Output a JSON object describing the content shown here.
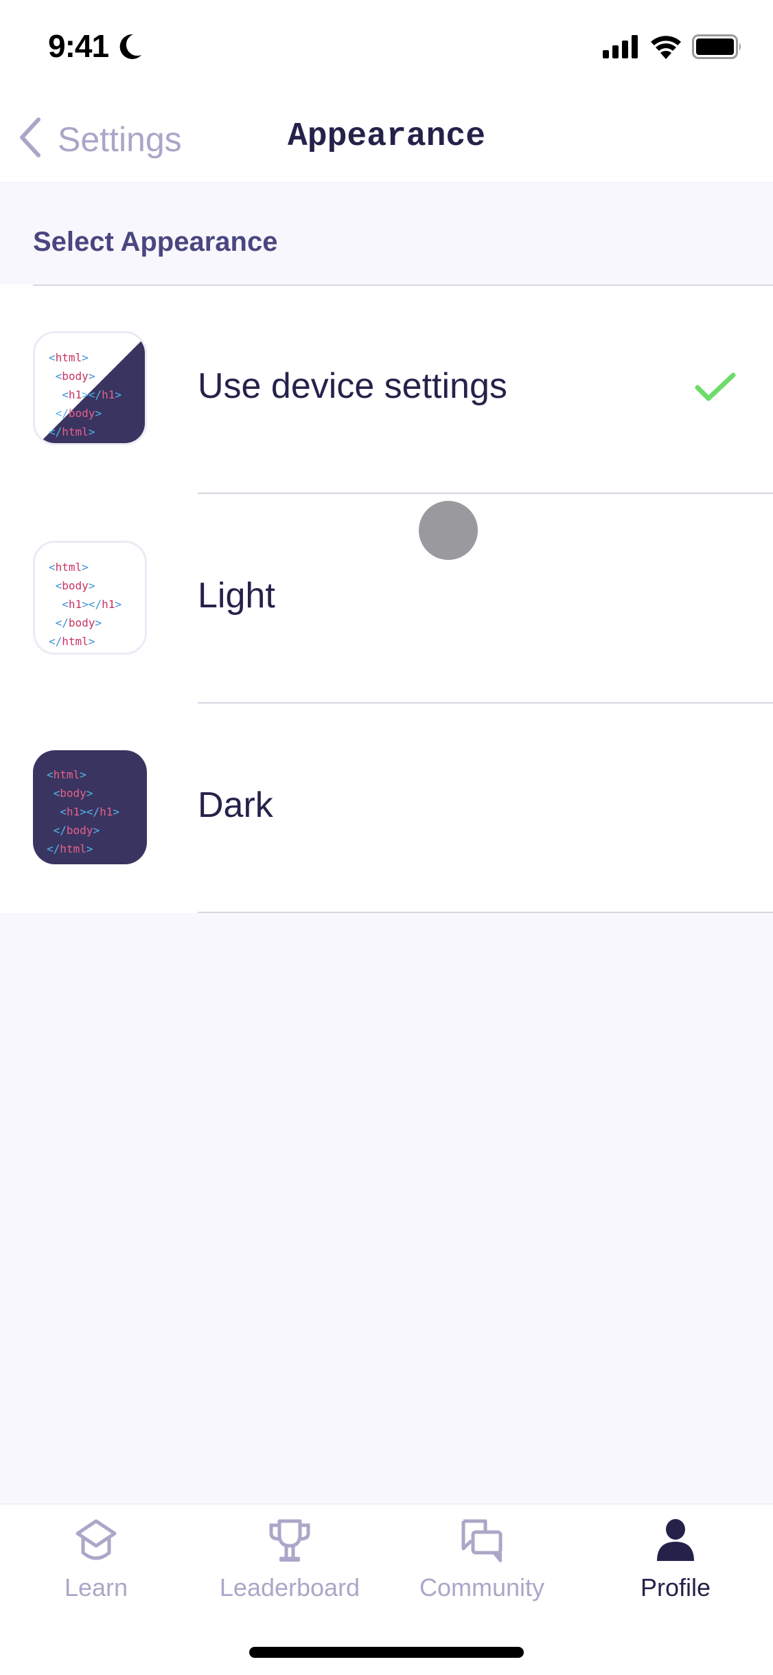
{
  "status_bar": {
    "time": "9:41",
    "focus_icon": "moon-icon",
    "icons": [
      "cellular-signal-icon",
      "wifi-icon",
      "battery-icon"
    ]
  },
  "nav": {
    "back_label": "Settings",
    "back_icon": "chevron-left-icon",
    "title": "Appearance"
  },
  "section": {
    "header": "Select Appearance"
  },
  "options": [
    {
      "label": "Use device settings",
      "thumbnail": "split-theme-preview",
      "selected": true
    },
    {
      "label": "Light",
      "thumbnail": "light-theme-preview",
      "selected": false
    },
    {
      "label": "Dark",
      "thumbnail": "dark-theme-preview",
      "selected": false
    }
  ],
  "preview_code": {
    "line1": "<html>",
    "line2": " <body>",
    "line3": "  <h1></h1>",
    "line4": " </body>",
    "line5": "</html>"
  },
  "colors": {
    "accent_check": "#6ddc6a",
    "text_primary": "#25224a",
    "text_muted": "#a9a6c8",
    "dark_preview_bg": "#393560",
    "code_tag_blue": "#3d8fd6",
    "code_tag_pink": "#c8325f"
  },
  "tab_bar": {
    "tabs": [
      {
        "label": "Learn",
        "icon": "graduation-cap-icon",
        "active": false
      },
      {
        "label": "Leaderboard",
        "icon": "trophy-icon",
        "active": false
      },
      {
        "label": "Community",
        "icon": "chat-bubbles-icon",
        "active": false
      },
      {
        "label": "Profile",
        "icon": "person-icon",
        "active": true
      }
    ]
  }
}
